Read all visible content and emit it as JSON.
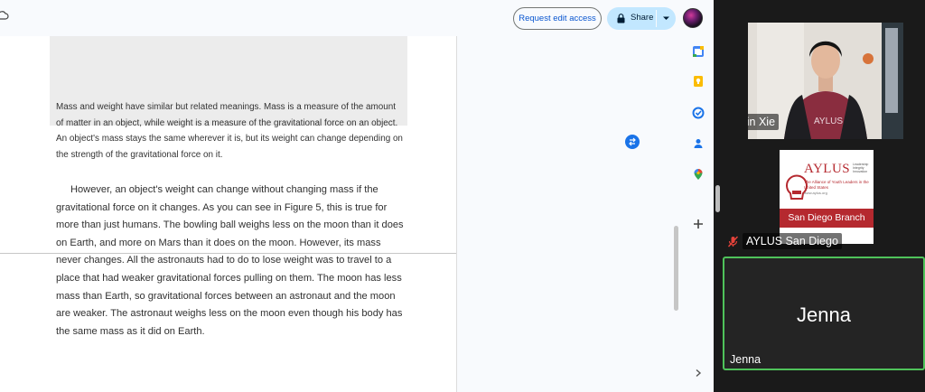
{
  "toolbar": {
    "request_edit_label": "Request edit access",
    "share_label": "Share"
  },
  "document": {
    "callout_text": "Mass and weight have similar but related meanings. Mass is a measure of the amount of matter in an object, while weight is a measure of the gravitational force on an object. An object's mass stays the same wherever it is, but its weight can change depending on the strength of the gravitational force on it.",
    "body_paragraph": "However, an object's weight can change without changing mass if the gravitational force on it changes. As you can see in Figure 5, this is true for more than just humans. The bowling ball weighs less on the moon than it does on Earth, and more on Mars than it does on the moon. However, its mass never changes. All the astronauts had to do to lose weight was to travel to a place that had weaker gravitational forces pulling on them. The moon has less mass than Earth, so gravitational forces between an astronaut and the moon are weaker. The astronaut weighs less on the moon even though his body has the same mass as it did on Earth."
  },
  "side_panel_icons": [
    "calendar-icon",
    "keep-icon",
    "tasks-icon",
    "contacts-icon",
    "maps-icon",
    "add-icon",
    "chevron-right-icon"
  ],
  "participants": {
    "colin": {
      "name": "Colin Xie"
    },
    "aylus": {
      "name": "AYLUS San Diego",
      "logo_title": "AYLUS",
      "logo_tagline_1": "Leadership",
      "logo_tagline_2": "Integrity",
      "logo_tagline_3": "Innovation",
      "logo_full_name": "The Alliance of Youth Leaders in the United States",
      "logo_url": "www.aylus.org",
      "branch_label": "San Diego Branch"
    },
    "jenna": {
      "name": "Jenna",
      "center_name": "Jenna"
    }
  },
  "colors": {
    "accent_blue": "#0b57d0",
    "share_bg": "#c2e7ff",
    "active_speaker": "#4fc35a",
    "aylus_red": "#b5292f"
  }
}
